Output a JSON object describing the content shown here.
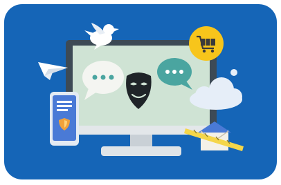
{
  "illustration": {
    "icons": [
      "bird-icon",
      "paper-plane-icon",
      "shopping-cart-icon",
      "chat-bubble-icon",
      "theater-mask-icon",
      "cloud-icon",
      "smartphone-icon",
      "shield-icon",
      "envelope-icon",
      "desktop-monitor-icon"
    ]
  },
  "colors": {
    "background_blue": "#1565b7",
    "monitor_frame": "#3d4a55",
    "screen": "#cfe3d4",
    "monitor_stand": "#dfe4e8",
    "cart_badge": "#f7c51b",
    "mask": "#1f2428",
    "chat_white": "#f4f5f1",
    "chat_teal": "#4aa5a0",
    "cloud": "#e6eef8",
    "phone_blue": "#4a7ad6",
    "shield": "#f2a23a",
    "envelope": "#f4f1e8",
    "tape": "#f5d64a"
  }
}
